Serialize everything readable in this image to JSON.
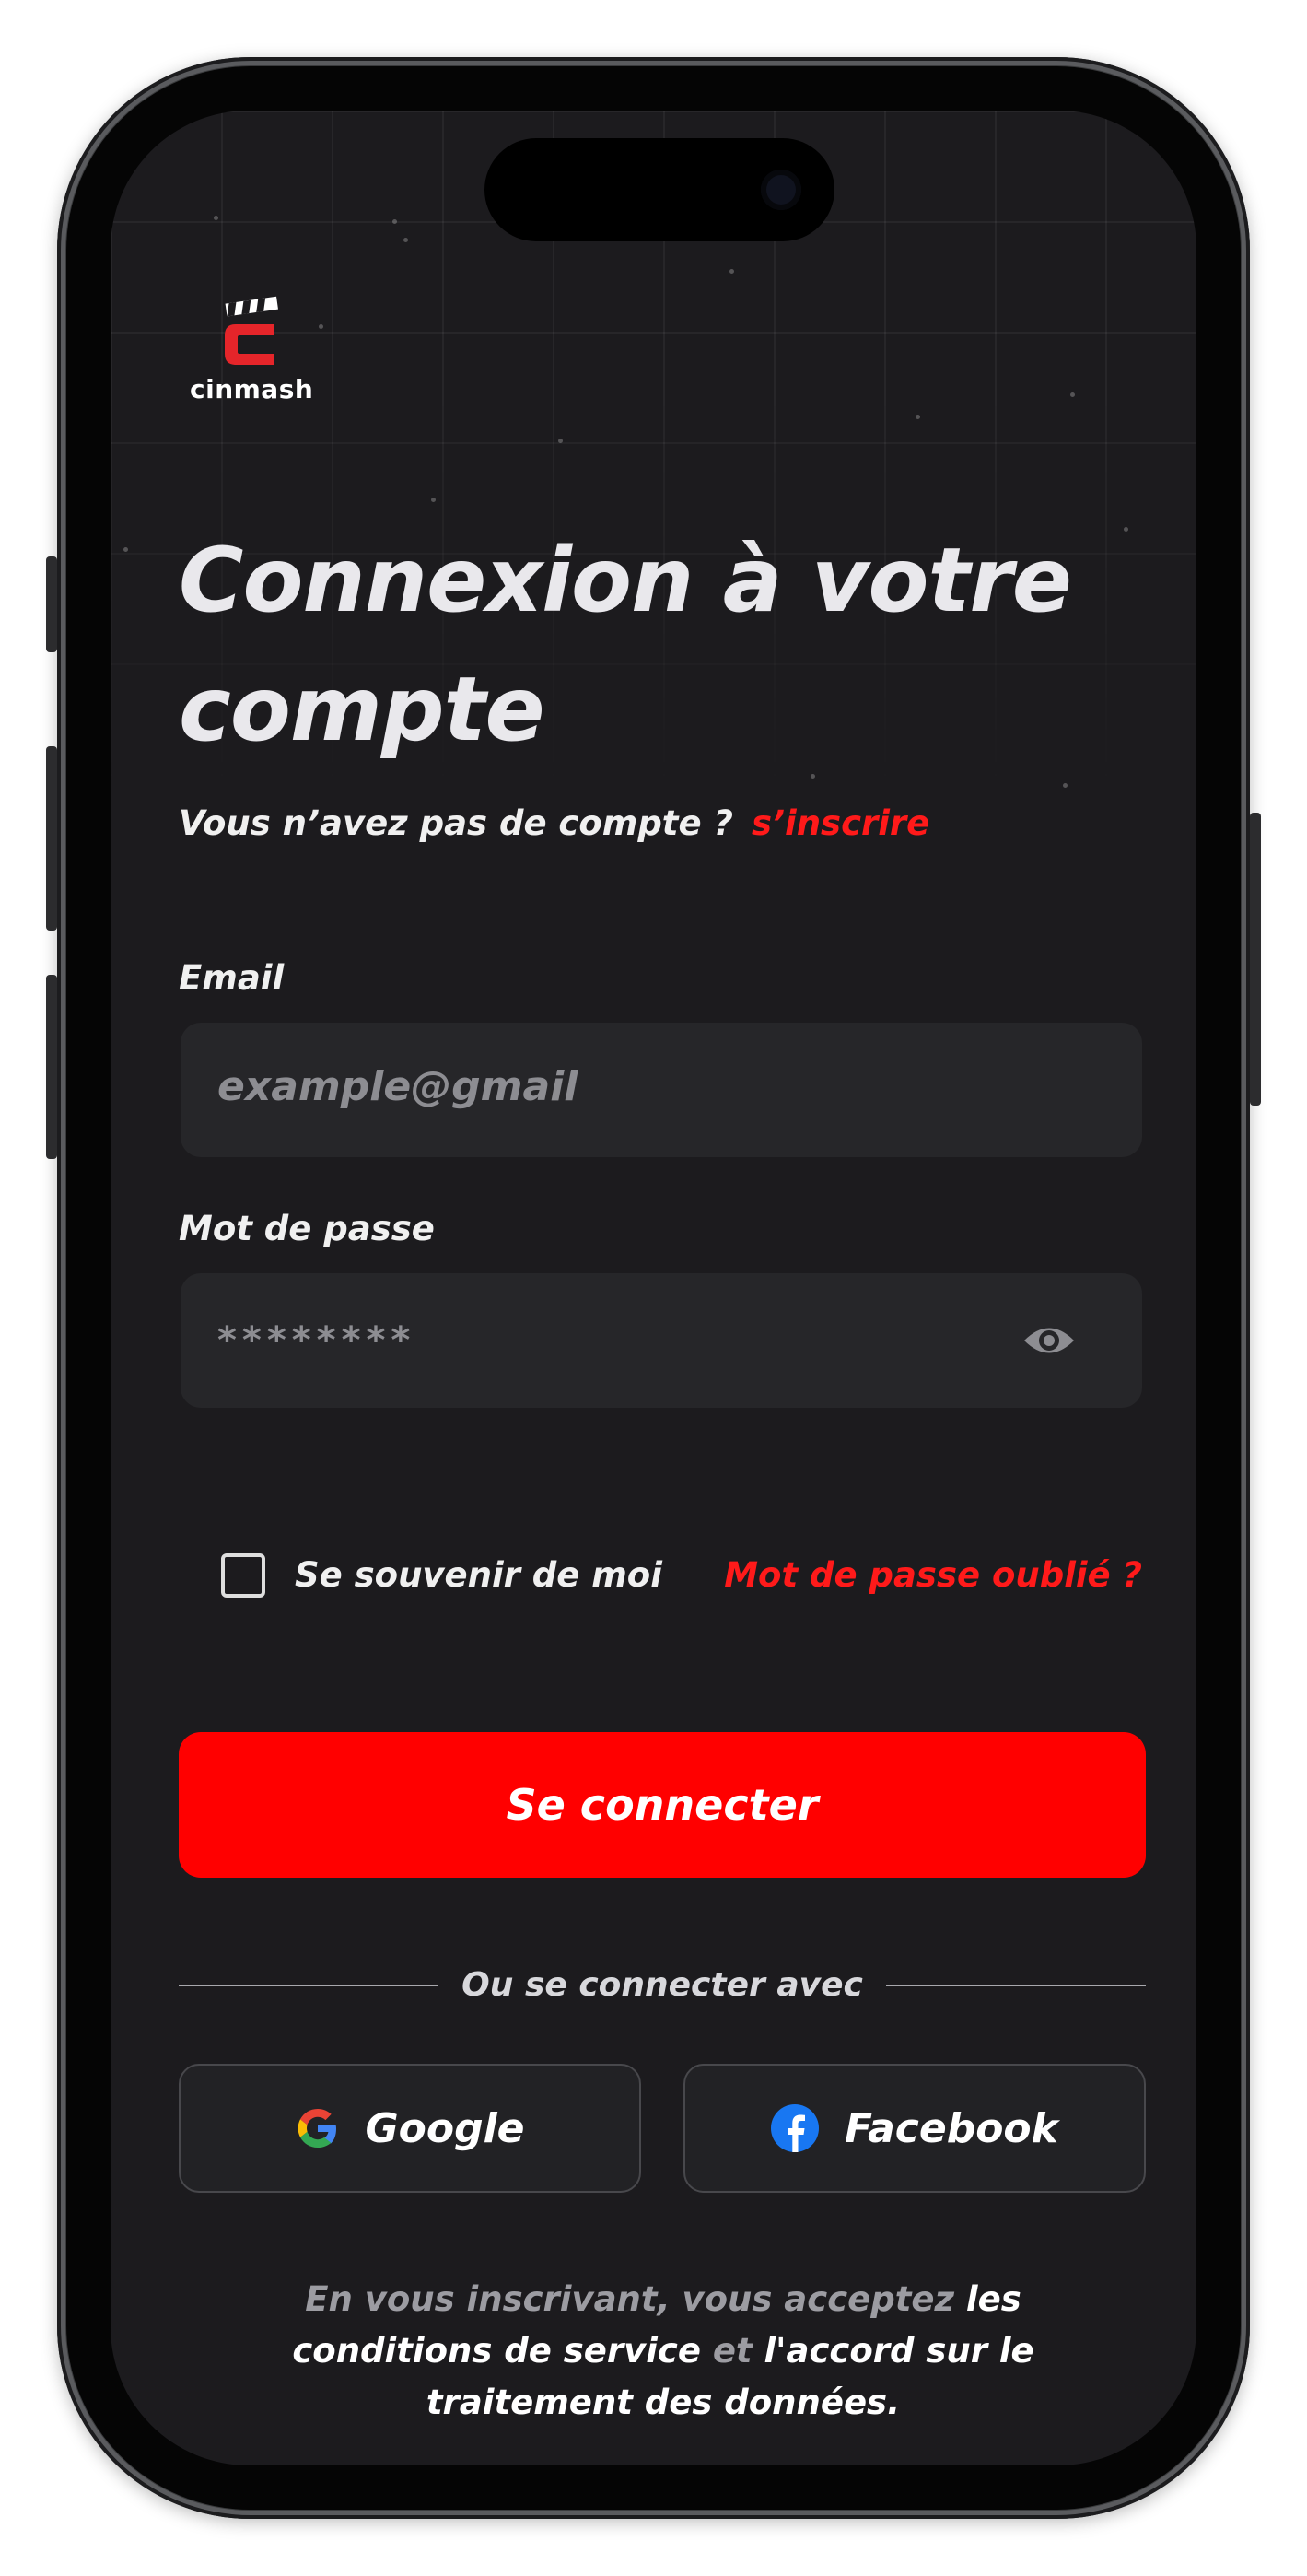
{
  "app": {
    "logo_text": "cinmash"
  },
  "header": {
    "title_line1": "Connexion à votre",
    "title_line2": "compte",
    "no_account_text": "Vous n’avez pas de compte ?",
    "signup_link": "s’inscrire"
  },
  "form": {
    "email_label": "Email",
    "email_placeholder": "example@gmail",
    "password_label": "Mot de passe",
    "password_value": "********",
    "remember_label": "Se souvenir de moi",
    "forgot_link": "Mot de passe oublié ?",
    "remember_checked": false
  },
  "actions": {
    "login_button": "Se connecter",
    "divider_text": "Ou se connecter avec",
    "google_button": "Google",
    "facebook_button": "Facebook"
  },
  "footer": {
    "terms_part1": "En vous inscrivant, vous acceptez",
    "terms_link1": "les conditions de service",
    "terms_part2": "et",
    "terms_link2": "l'accord sur le traitement des données."
  },
  "colors": {
    "accent": "#ff0000",
    "background": "#1c1b1e",
    "field": "#262629",
    "link": "#ff1a1a"
  },
  "icons": [
    "cinmash-logo-icon",
    "eye-icon",
    "google-icon",
    "facebook-icon",
    "checkbox-icon"
  ]
}
